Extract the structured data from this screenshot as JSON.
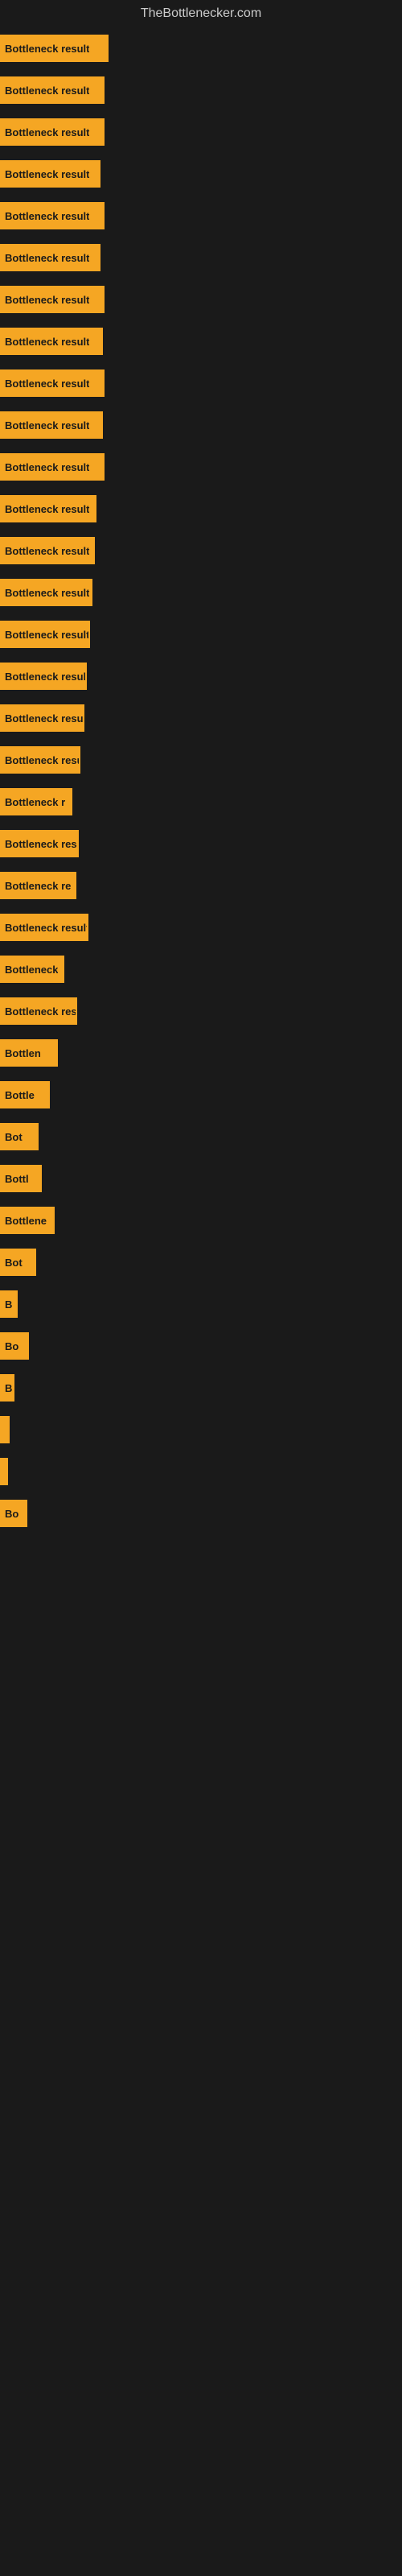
{
  "site": {
    "title": "TheBottlenecker.com"
  },
  "bars": [
    {
      "label": "Bottleneck result",
      "width": 135,
      "visible_label": "Bottleneck result"
    },
    {
      "label": "Bottleneck result",
      "width": 130,
      "visible_label": "Bottleneck result"
    },
    {
      "label": "Bottleneck result",
      "width": 130,
      "visible_label": "Bottleneck result"
    },
    {
      "label": "Bottleneck result",
      "width": 125,
      "visible_label": "Bottleneck result"
    },
    {
      "label": "Bottleneck result",
      "width": 130,
      "visible_label": "Bottleneck result"
    },
    {
      "label": "Bottleneck result",
      "width": 125,
      "visible_label": "Bottleneck result"
    },
    {
      "label": "Bottleneck result",
      "width": 130,
      "visible_label": "Bottleneck result"
    },
    {
      "label": "Bottleneck result",
      "width": 128,
      "visible_label": "Bottleneck result"
    },
    {
      "label": "Bottleneck result",
      "width": 130,
      "visible_label": "Bottleneck result"
    },
    {
      "label": "Bottleneck result",
      "width": 128,
      "visible_label": "Bottleneck result"
    },
    {
      "label": "Bottleneck result",
      "width": 130,
      "visible_label": "Bottleneck result"
    },
    {
      "label": "Bottleneck result",
      "width": 120,
      "visible_label": "Bottleneck result"
    },
    {
      "label": "Bottleneck result",
      "width": 118,
      "visible_label": "Bottleneck result"
    },
    {
      "label": "Bottleneck result",
      "width": 115,
      "visible_label": "Bottleneck result"
    },
    {
      "label": "Bottleneck result",
      "width": 112,
      "visible_label": "Bottleneck result"
    },
    {
      "label": "Bottleneck result",
      "width": 108,
      "visible_label": "Bottleneck result"
    },
    {
      "label": "Bottleneck result",
      "width": 105,
      "visible_label": "Bottleneck result"
    },
    {
      "label": "Bottleneck resu",
      "width": 100,
      "visible_label": "Bottleneck resu"
    },
    {
      "label": "Bottleneck r",
      "width": 90,
      "visible_label": "Bottleneck r"
    },
    {
      "label": "Bottleneck resu",
      "width": 98,
      "visible_label": "Bottleneck resu"
    },
    {
      "label": "Bottleneck re",
      "width": 95,
      "visible_label": "Bottleneck re"
    },
    {
      "label": "Bottleneck result",
      "width": 110,
      "visible_label": "Bottleneck result"
    },
    {
      "label": "Bottleneck",
      "width": 80,
      "visible_label": "Bottleneck"
    },
    {
      "label": "Bottleneck resu",
      "width": 96,
      "visible_label": "Bottleneck resu"
    },
    {
      "label": "Bottlen",
      "width": 72,
      "visible_label": "Bottlen"
    },
    {
      "label": "Bottle",
      "width": 62,
      "visible_label": "Bottle"
    },
    {
      "label": "Bot",
      "width": 48,
      "visible_label": "Bot"
    },
    {
      "label": "Bottl",
      "width": 52,
      "visible_label": "Bottl"
    },
    {
      "label": "Bottlene",
      "width": 68,
      "visible_label": "Bottlene"
    },
    {
      "label": "Bot",
      "width": 45,
      "visible_label": "Bot"
    },
    {
      "label": "B",
      "width": 22,
      "visible_label": "B"
    },
    {
      "label": "Bo",
      "width": 36,
      "visible_label": "Bo"
    },
    {
      "label": "B",
      "width": 18,
      "visible_label": "B"
    },
    {
      "label": "",
      "width": 12,
      "visible_label": ""
    },
    {
      "label": "",
      "width": 10,
      "visible_label": ""
    },
    {
      "label": "Bo",
      "width": 34,
      "visible_label": "Bo"
    }
  ]
}
